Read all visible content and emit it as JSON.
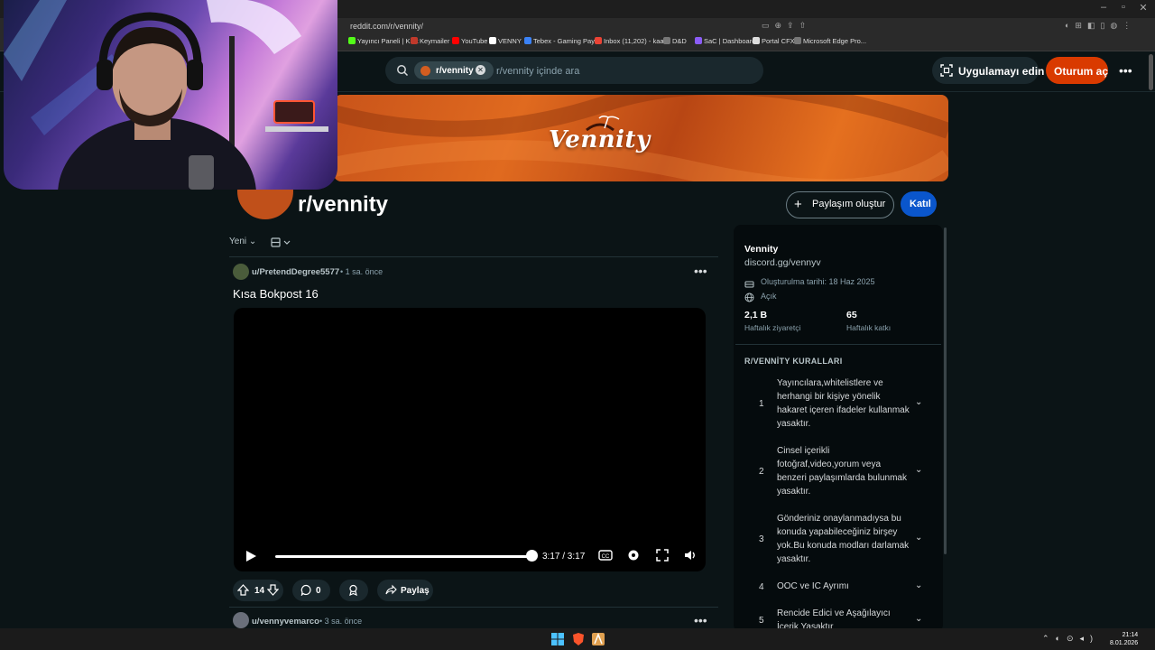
{
  "browser": {
    "url": "reddit.com/r/vennity/",
    "bookmarks": [
      "Yayıncı Paneli | Kick",
      "Keymailer",
      "YouTube",
      "VENNY",
      "Tebex - Gaming Pay...",
      "Inbox (11,202) - kaa...",
      "D&D",
      "SaC | Dashboard",
      "Portal CFX",
      "Microsoft Edge Pro..."
    ]
  },
  "header": {
    "search_chip": "r/vennity",
    "search_placeholder": "r/vennity içinde ara",
    "app_button": "Uygulamayı edin",
    "login_button": "Oturum aç"
  },
  "community": {
    "banner_logo": "Vennity",
    "name": "r/vennity",
    "create_post": "Paylaşım oluştur",
    "join": "Katıl"
  },
  "feed": {
    "sort": "Yeni",
    "posts": [
      {
        "author": "u/PretendDegree5577",
        "time": "1 sa. önce",
        "title": "Kısa Bokpost 16",
        "video_time": "3:17 / 3:17",
        "video_progress": 1.0,
        "votes": "14",
        "comments": "0",
        "share": "Paylaş"
      },
      {
        "author": "u/vennyvemarco",
        "time": "3 sa. önce"
      }
    ]
  },
  "sidebar": {
    "title": "Vennity",
    "link": "discord.gg/vennyv",
    "created": "Oluşturulma tarihi: 18 Haz 2025",
    "visibility": "Açık",
    "visitors_value": "2,1 B",
    "visitors_label": "Haftalık ziyaretçi",
    "contrib_value": "65",
    "contrib_label": "Haftalık katkı",
    "rules_heading": "R/VENNİTY KURALLARI",
    "rules": [
      {
        "num": "1",
        "text": "Yayıncılara,whitelistlere ve herhangi bir kişiye yönelik hakaret içeren ifadeler kullanmak yasaktır."
      },
      {
        "num": "2",
        "text": "Cinsel içerikli fotoğraf,video,yorum veya benzeri paylaşımlarda bulunmak yasaktır."
      },
      {
        "num": "3",
        "text": "Gönderiniz onaylanmadıysa bu konuda yapabileceğiniz birşey yok.Bu konuda modları darlamak yasaktır."
      },
      {
        "num": "4",
        "text": "OOC ve IC Ayrımı"
      },
      {
        "num": "5",
        "text": "Rencide Edici ve Aşağılayıcı İçerik Yasaktır"
      }
    ]
  },
  "taskbar": {
    "time": "21:14",
    "date": "8.01.2026"
  },
  "colors": {
    "background": "#0b1416",
    "accent_orange": "#d93a00",
    "join_blue": "#0a56cc"
  }
}
